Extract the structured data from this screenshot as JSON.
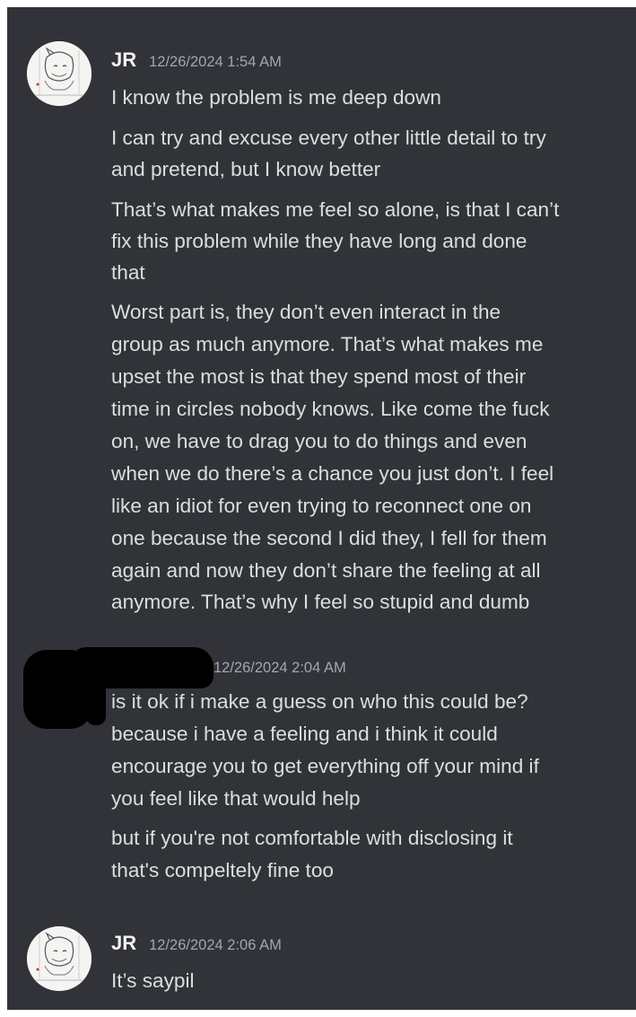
{
  "messages": [
    {
      "username": "JR",
      "timestamp": "12/26/2024 1:54 AM",
      "paragraphs": [
        [
          "I know the problem is me deep down"
        ],
        [
          "I can try and excuse every other little detail to try",
          "and pretend, but I know better"
        ],
        [
          "That’s what makes me feel so alone, is that I can’t",
          "fix this problem while they have long and done",
          "that"
        ],
        [
          "Worst part is, they don’t even interact in the",
          "group as much anymore. That’s what makes me",
          "upset the most is that they spend most of their",
          "time in circles nobody knows. Like come the fuck",
          "on, we have to drag you to do things and even",
          "when we do there’s a chance you just don’t. I feel",
          "like an idiot for even trying to reconnect one on",
          "one because the second I did they, I fell for them",
          "again and now they don’t share the feeling at all",
          "anymore. That’s why I feel so stupid and dumb"
        ]
      ]
    },
    {
      "username": "",
      "timestamp": "12/26/2024 2:04 AM",
      "paragraphs": [
        [
          "is it ok if i make a guess on who this could be?",
          "because i have a feeling and i think it could",
          "encourage you to get everything off your mind if",
          "you feel like that would help"
        ],
        [
          "but if you're not comfortable with disclosing it",
          "that's compeltely fine too"
        ]
      ]
    },
    {
      "username": "JR",
      "timestamp": "12/26/2024 2:06 AM",
      "paragraphs": [
        [
          "It’s saypil"
        ]
      ]
    }
  ],
  "colors": {
    "background": "#313338",
    "text": "#dbdee1",
    "username": "#f2f3f5",
    "timestamp": "#a3a6ad"
  }
}
